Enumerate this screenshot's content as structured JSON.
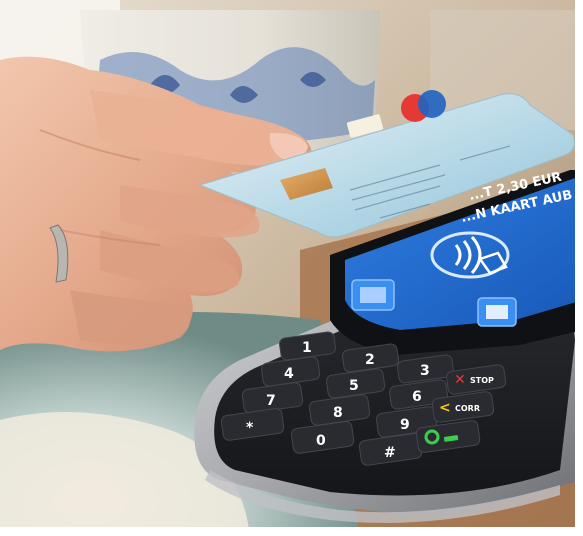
{
  "scene": {
    "screen": {
      "line1": "...T 2,30 EUR",
      "line2": "...N KAART AUB"
    },
    "keypad": {
      "keys": [
        "1",
        "2",
        "3",
        "4",
        "5",
        "6",
        "7",
        "8",
        "9",
        "*",
        "0",
        "#"
      ],
      "stop_label": "STOP",
      "corr_label": "CORR"
    }
  }
}
